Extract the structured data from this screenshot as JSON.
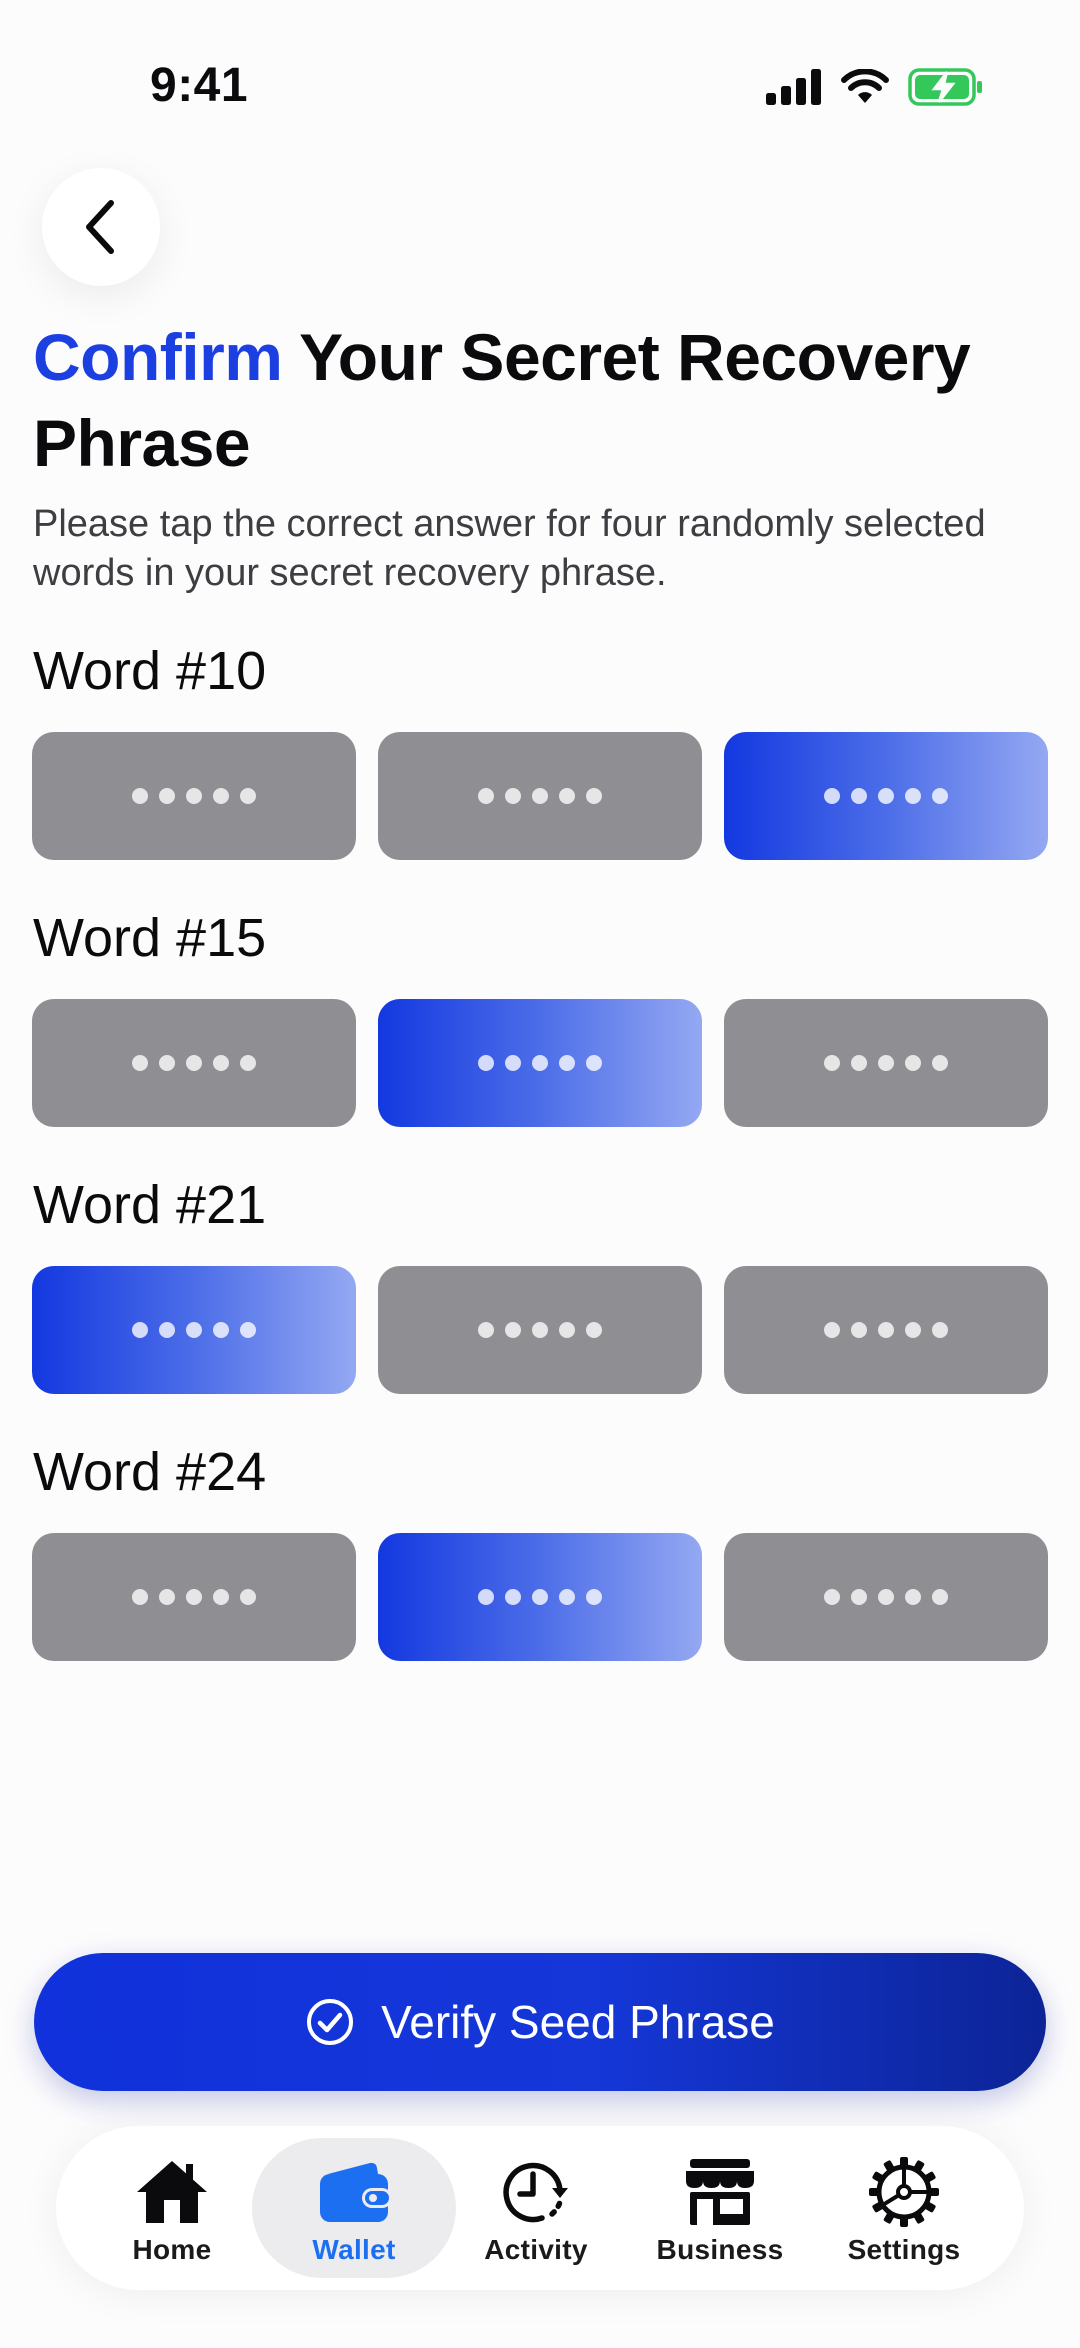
{
  "status_bar": {
    "time": "9:41"
  },
  "header": {
    "title_accent": "Confirm",
    "title_rest": "Your Secret Recovery Phrase",
    "subtitle": "Please tap the correct answer for four randomly selected words in your secret recovery phrase."
  },
  "word_groups": [
    {
      "label": "Word #10",
      "selected_index": 2
    },
    {
      "label": "Word #15",
      "selected_index": 1
    },
    {
      "label": "Word #21",
      "selected_index": 0
    },
    {
      "label": "Word #24",
      "selected_index": 1
    }
  ],
  "verify_button": {
    "label": "Verify Seed Phrase"
  },
  "tab_bar": {
    "active": "Wallet",
    "items": [
      {
        "label": "Home",
        "icon": "home-icon"
      },
      {
        "label": "Wallet",
        "icon": "wallet-icon"
      },
      {
        "label": "Activity",
        "icon": "activity-clock-icon"
      },
      {
        "label": "Business",
        "icon": "storefront-icon"
      },
      {
        "label": "Settings",
        "icon": "gear-icon"
      }
    ]
  },
  "colors": {
    "accent": "#1b3fe0",
    "option_default": "#8f8e93",
    "tab_active_label": "#1d6ff2",
    "battery": "#34c759"
  }
}
